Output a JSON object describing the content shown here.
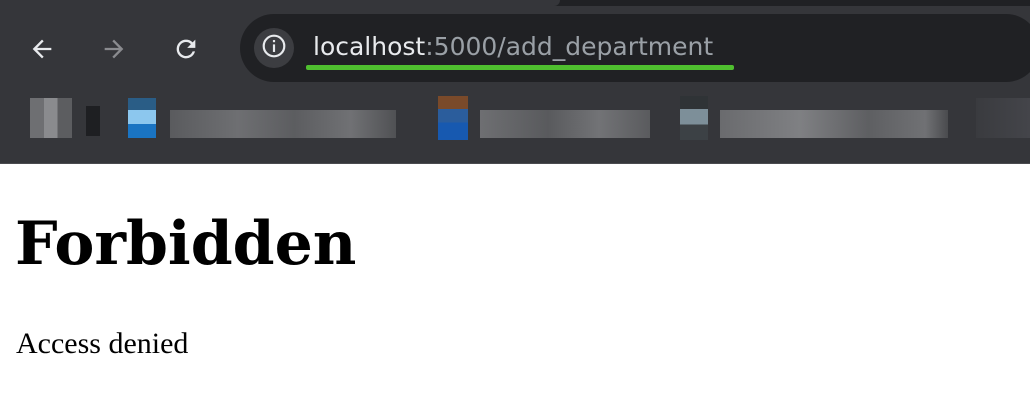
{
  "browser": {
    "url_host": "localhost",
    "url_path": ":5000/add_department",
    "icons": {
      "back": "back-arrow-icon",
      "forward": "forward-arrow-icon",
      "reload": "reload-icon",
      "site_info": "info-icon"
    },
    "colors": {
      "chrome_bg": "#35363a",
      "omnibox_bg": "#202124",
      "url_highlight": "#4fbf2f"
    }
  },
  "page": {
    "heading": "Forbidden",
    "message": "Access denied"
  }
}
